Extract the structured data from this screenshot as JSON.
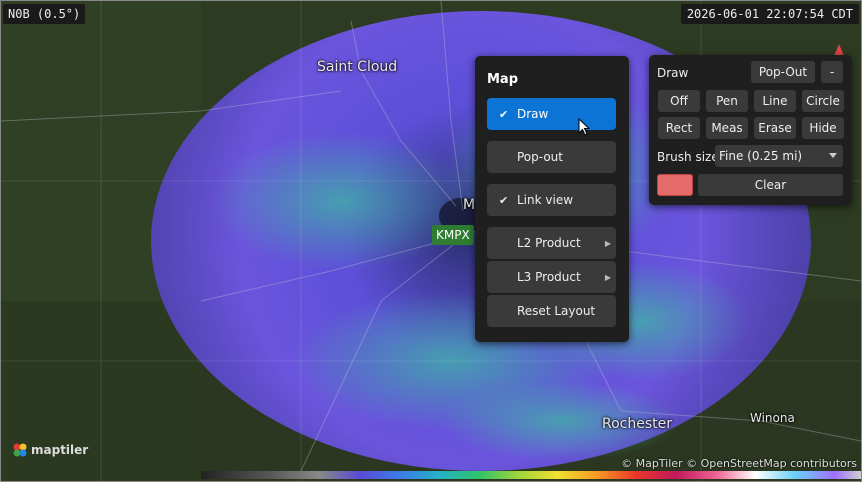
{
  "top_bar": {
    "product": "N0B (0.5°)",
    "timestamp": "2026-06-01 22:07:54 CDT"
  },
  "cities": {
    "saint_cloud": "Saint Cloud",
    "rochester": "Rochester",
    "winona": "Winona",
    "minneapolis_partial": "M"
  },
  "station": "KMPX",
  "logo": "maptiler",
  "attribution": "© MapTiler © OpenStreetMap contributors",
  "map_menu": {
    "title": "Map",
    "items": [
      {
        "label": "Draw",
        "checked": true,
        "active": true,
        "submenu": false
      },
      {
        "label": "Pop-out",
        "checked": false,
        "active": false,
        "submenu": false
      },
      {
        "label": "Link view",
        "checked": true,
        "active": false,
        "submenu": false
      },
      {
        "label": "L2 Product",
        "checked": false,
        "active": false,
        "submenu": true
      },
      {
        "label": "L3 Product",
        "checked": false,
        "active": false,
        "submenu": true
      },
      {
        "label": "Reset Layout",
        "checked": false,
        "active": false,
        "submenu": false
      }
    ],
    "check_glyph": "✔",
    "arrow_glyph": "▶"
  },
  "draw_panel": {
    "title": "Draw",
    "popout_label": "Pop-Out",
    "collapse_label": "-",
    "tools_row1": [
      "Off",
      "Pen",
      "Line",
      "Circle"
    ],
    "tools_row2": [
      "Rect",
      "Meas",
      "Erase",
      "Hide"
    ],
    "brush_label": "Brush size",
    "brush_value": "Fine (0.25 mi)",
    "clear_label": "Clear",
    "swatch_color": "#e56a6a"
  },
  "colors": {
    "menu_active": "#0b74d4",
    "radar_base": "#5a4bd6",
    "station_badge": "#2e7d32"
  }
}
